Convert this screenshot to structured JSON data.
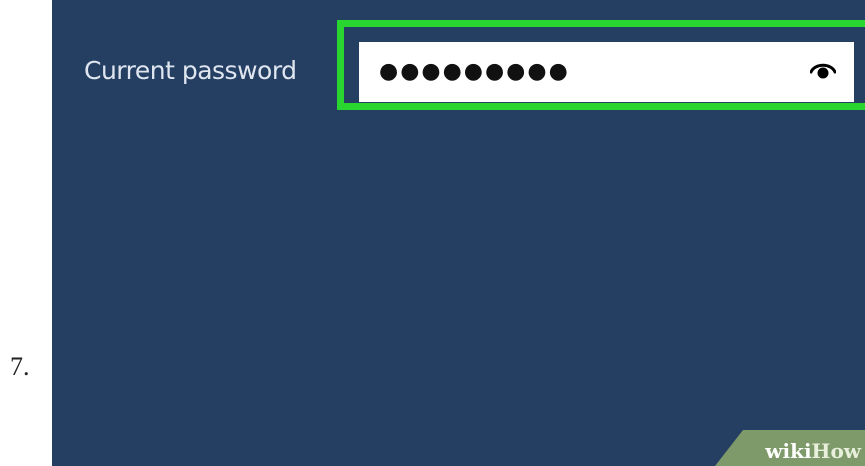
{
  "step": {
    "number": "7."
  },
  "form": {
    "label": "Current password",
    "password_mask": "●●●●●●●●●",
    "reveal_icon": "eye-icon"
  },
  "watermark": {
    "prefix": "wiki",
    "suffix": "How"
  },
  "colors": {
    "panel_background": "#253f63",
    "highlight": "#29d630",
    "label_text": "#dfe6ef",
    "input_background": "#ffffff",
    "watermark_band": "#7e9a6a"
  }
}
